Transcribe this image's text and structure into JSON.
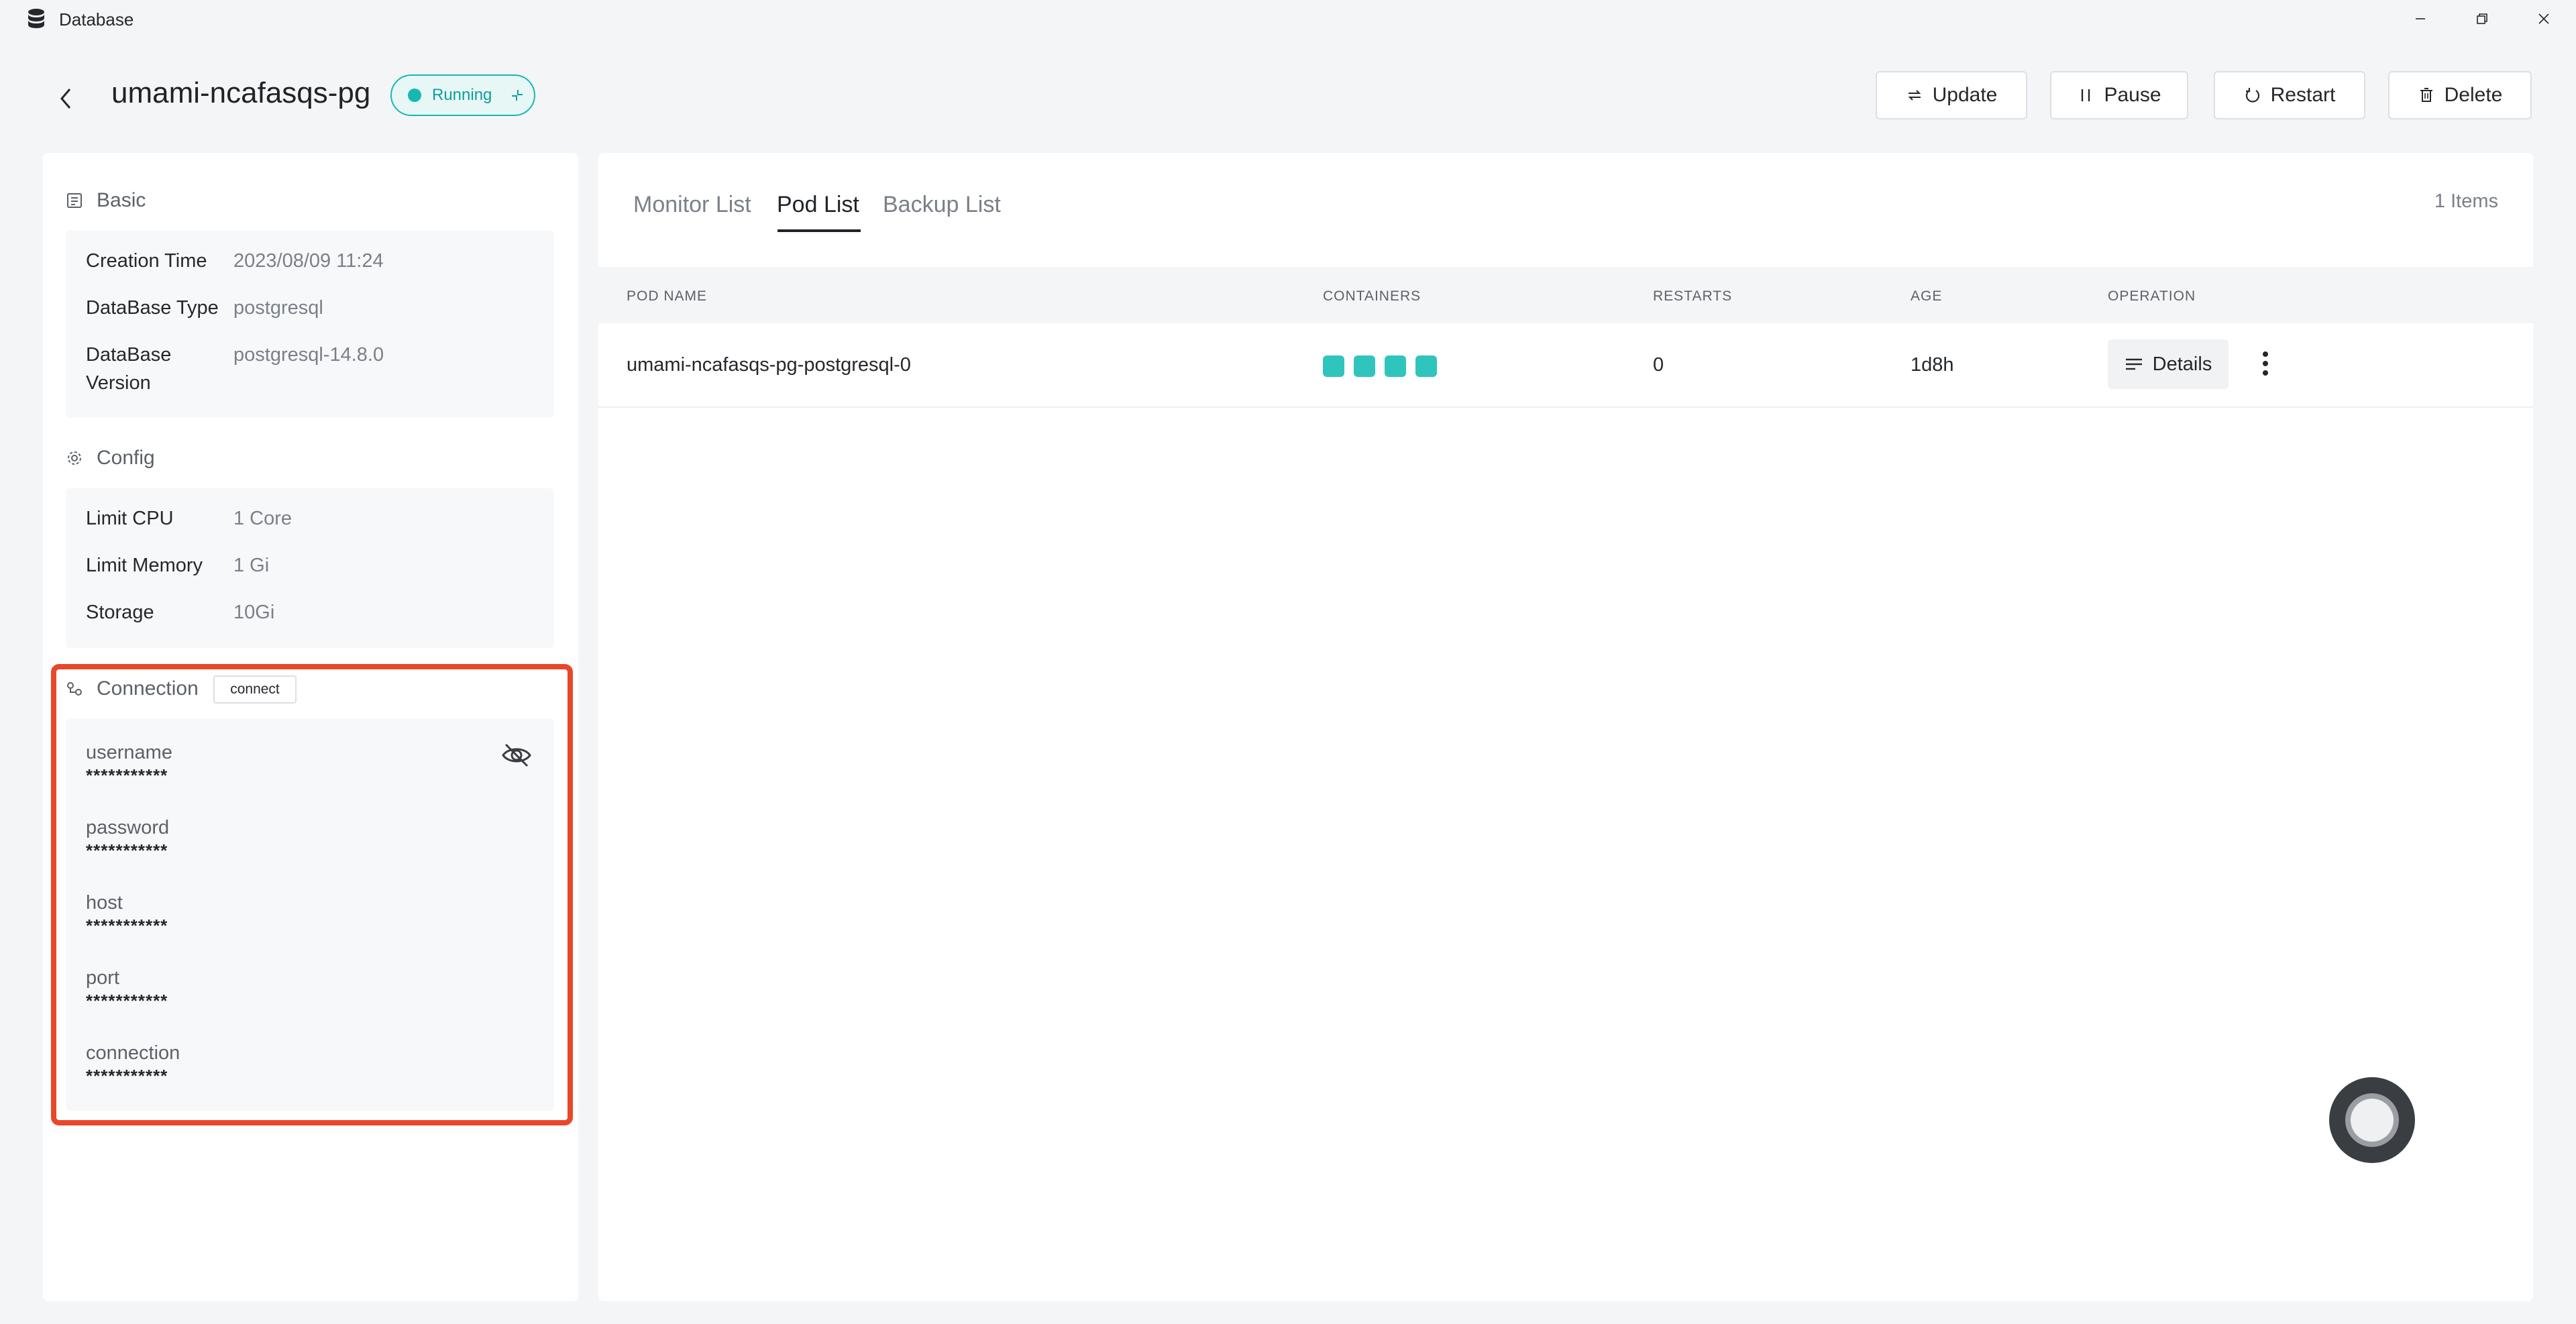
{
  "window": {
    "title": "Database"
  },
  "header": {
    "title": "umami-ncafasqs-pg",
    "status": "Running",
    "buttons": {
      "update": "Update",
      "pause": "Pause",
      "restart": "Restart",
      "delete": "Delete"
    }
  },
  "basic": {
    "heading": "Basic",
    "rows": [
      {
        "label": "Creation Time",
        "value": "2023/08/09 11:24"
      },
      {
        "label": "DataBase Type",
        "value": "postgresql"
      },
      {
        "label": "DataBase Version",
        "value": "postgresql-14.8.0"
      }
    ]
  },
  "config": {
    "heading": "Config",
    "rows": [
      {
        "label": "Limit CPU",
        "value": "1 Core"
      },
      {
        "label": "Limit Memory",
        "value": "1 Gi"
      },
      {
        "label": "Storage",
        "value": "10Gi"
      }
    ]
  },
  "connection": {
    "heading": "Connection",
    "connect_label": "connect",
    "items": [
      {
        "label": "username",
        "value": "***********"
      },
      {
        "label": "password",
        "value": "***********"
      },
      {
        "label": "host",
        "value": "***********"
      },
      {
        "label": "port",
        "value": "***********"
      },
      {
        "label": "connection",
        "value": "***********"
      }
    ]
  },
  "tabs": [
    {
      "label": "Monitor List",
      "active": false
    },
    {
      "label": "Pod List",
      "active": true
    },
    {
      "label": "Backup List",
      "active": false
    }
  ],
  "items_count": "1 Items",
  "table": {
    "columns": [
      "POD NAME",
      "CONTAINERS",
      "RESTARTS",
      "AGE",
      "OPERATION"
    ],
    "rows": [
      {
        "pod_name": "umami-ncafasqs-pg-postgresql-0",
        "containers": 4,
        "restarts": "0",
        "age": "1d8h",
        "details_label": "Details"
      }
    ]
  },
  "colors": {
    "accent": "#17b8b0",
    "highlight": "#e8472a"
  }
}
